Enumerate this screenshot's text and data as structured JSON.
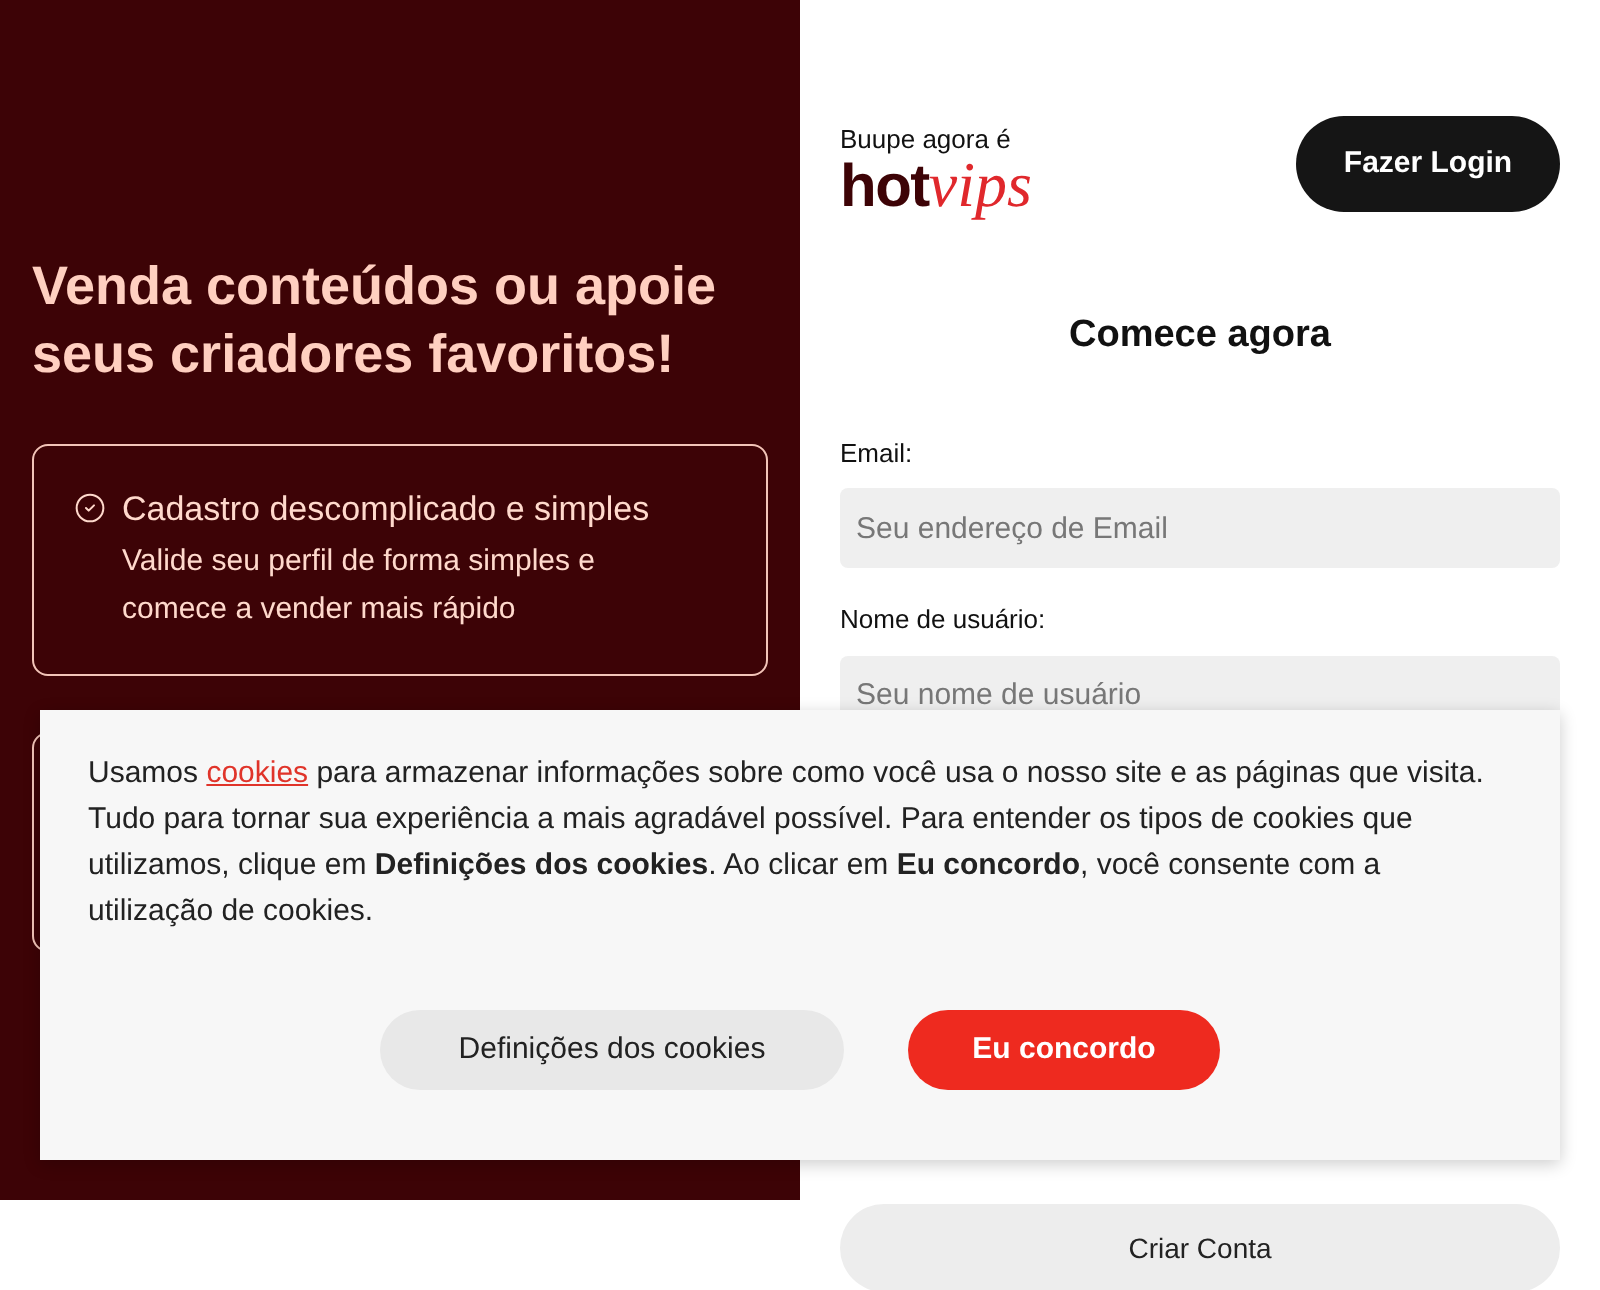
{
  "hero": {
    "title": "Venda conteúdos ou apoie seus criadores favoritos!",
    "features": [
      {
        "title": "Cadastro descomplicado e simples",
        "description": "Valide seu perfil de forma simples e comece a vender mais rápido"
      }
    ]
  },
  "brand": {
    "tagline": "Buupe agora é",
    "logo_part_1": "hot",
    "logo_part_2": "vips"
  },
  "login_button": "Fazer Login",
  "form": {
    "title": "Comece agora",
    "fields": [
      {
        "label": "Email:",
        "placeholder": "Seu endereço de Email"
      },
      {
        "label": "Nome de usuário:",
        "placeholder": "Seu nome de usuário"
      }
    ],
    "submit": "Criar Conta"
  },
  "cookie_banner": {
    "text_before": "Usamos ",
    "link": "cookies",
    "text_after": " para armazenar informações sobre como você usa o nosso site e as páginas que visita. Tudo para tornar sua experiência a mais agradável possível. Para entender os tipos de cookies que utilizamos, clique em **Definições dos cookies**. Ao clicar em **Eu concordo**, você consente com a utilização de cookies.",
    "buttons": [
      {
        "label": "Definições dos cookies",
        "kind": "secondary"
      },
      {
        "label": "Eu concordo",
        "kind": "primary"
      }
    ]
  }
}
